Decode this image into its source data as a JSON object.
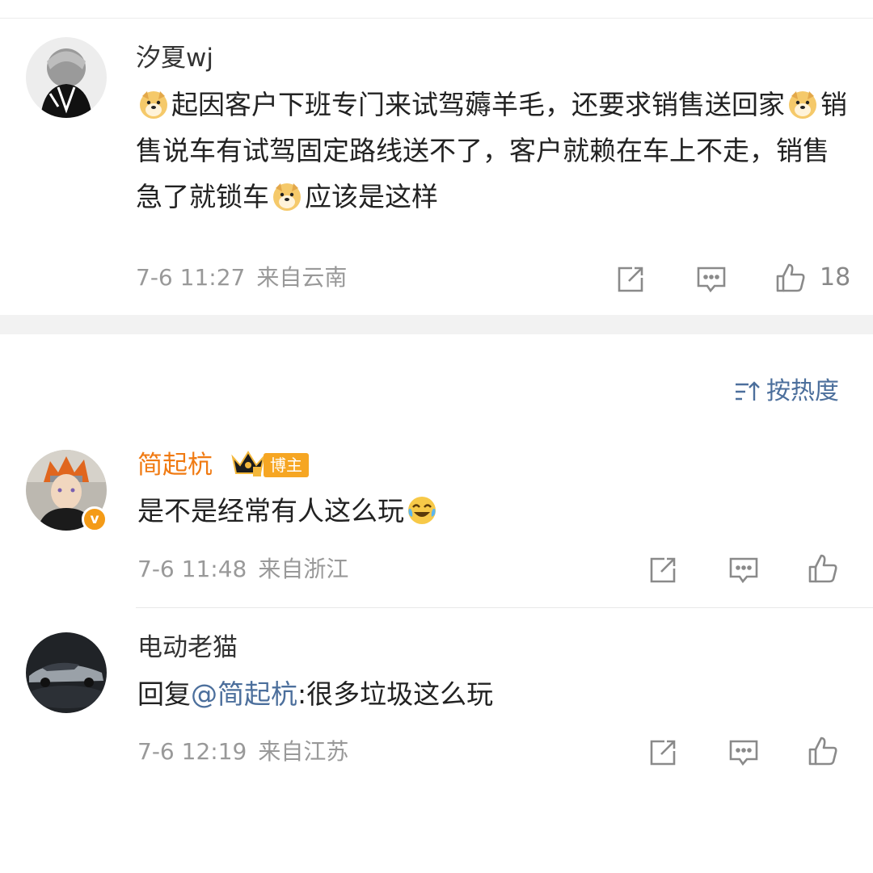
{
  "post": {
    "username": "汐夏wj",
    "text_segments": [
      "起因客户下班专门来试驾薅羊毛，还要求销售送回家",
      "销售说车有试驾固定路线送不了，客户就赖在车上不走，销售急了就锁车",
      "应该是这样"
    ],
    "time": "7-6 11:27",
    "location": "来自云南",
    "like_count": "18",
    "icons": [
      "share-icon",
      "comment-icon",
      "like-icon",
      "doge-emoji"
    ]
  },
  "sort": {
    "label": "按热度",
    "icon": "sort-icon"
  },
  "comments": [
    {
      "username": "简起杭",
      "badge": "博主",
      "verified_mark": "v",
      "text": "是不是经常有人这么玩",
      "emoji": "laugh-cry-emoji",
      "time": "7-6 11:48",
      "location": "来自浙江"
    },
    {
      "username": "电动老猫",
      "reply_prefix": "回复",
      "mention": "@简起杭",
      "text": ":很多垃圾这么玩",
      "time": "7-6 12:19",
      "location": "来自江苏"
    }
  ],
  "colors": {
    "accent_blue": "#4c6f9c",
    "blogger_orange": "#f07a12",
    "badge_orange": "#f6a623",
    "meta_gray": "#999999"
  }
}
